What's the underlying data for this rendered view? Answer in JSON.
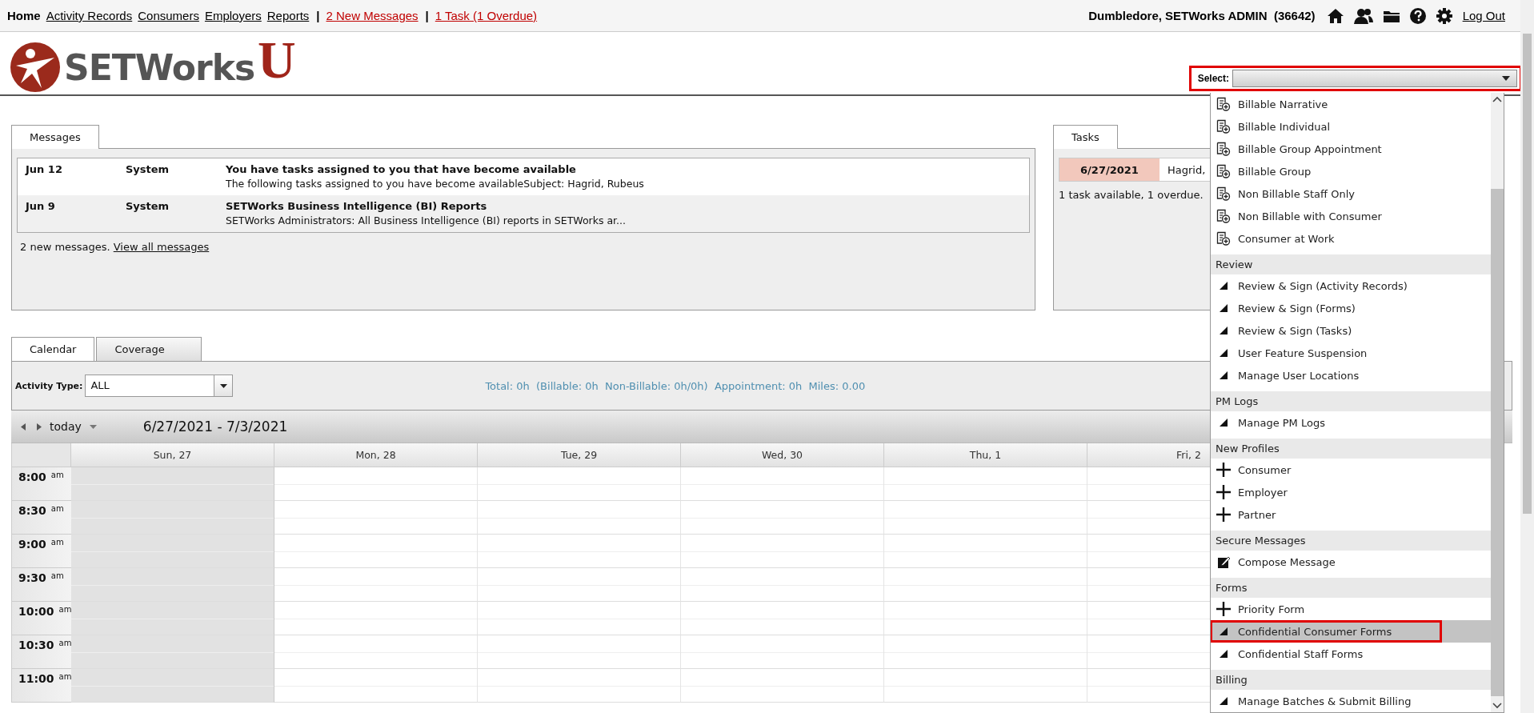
{
  "nav": {
    "links": [
      {
        "label": "Home",
        "selected": true
      },
      {
        "label": "Activity Records",
        "selected": false
      },
      {
        "label": "Consumers",
        "selected": false
      },
      {
        "label": "Employers",
        "selected": false
      },
      {
        "label": "Reports",
        "selected": false
      }
    ],
    "separator": "|",
    "alerts": [
      "2 New Messages",
      "1 Task (1 Overdue)"
    ],
    "user": "Dumbledore, SETWorks ADMIN  (36642)",
    "logout": "Log Out"
  },
  "logo": {
    "name": "SETWorks",
    "letter": "U"
  },
  "select": {
    "label": "Select:",
    "open": true
  },
  "messages": {
    "tab": "Messages",
    "rows": [
      {
        "date": "Jun 12",
        "from": "System",
        "subject": "You have tasks assigned to you that have become available",
        "preview": "The following tasks assigned to you have become availableSubject: Hagrid, Rubeus"
      },
      {
        "date": "Jun 9",
        "from": "System",
        "subject": "SETWorks Business Intelligence (BI) Reports",
        "preview": "SETWorks Administrators: All Business Intelligence (BI) reports in SETWorks ar..."
      }
    ],
    "summary": "2 new messages.",
    "link": "View all messages"
  },
  "tasks": {
    "tab": "Tasks",
    "rows": [
      {
        "date": "6/27/2021",
        "name": "Hagrid,",
        "overdue": true
      }
    ],
    "summary": "1 task available, 1 overdue."
  },
  "calendar": {
    "tabs": [
      {
        "label": "Calendar",
        "selected": true
      },
      {
        "label": "Coverage",
        "selected": false
      }
    ],
    "activity_label": "Activity Type:",
    "activity_value": "ALL",
    "totals": "Total: 0h  (Billable: 0h  Non-Billable: 0h/0h)  Appointment: 0h  Miles: 0.00",
    "today": "today",
    "range": "6/27/2021 - 7/3/2021",
    "days": [
      {
        "label": "Sun, 27",
        "shaded": true
      },
      {
        "label": "Mon, 28",
        "shaded": false
      },
      {
        "label": "Tue, 29",
        "shaded": false
      },
      {
        "label": "Wed, 30",
        "shaded": false
      },
      {
        "label": "Thu, 1",
        "shaded": false
      },
      {
        "label": "Fri, 2",
        "shaded": false
      }
    ],
    "times": [
      {
        "time": "8:00",
        "period": "am"
      },
      {
        "time": "8:30",
        "period": "am"
      },
      {
        "time": "9:00",
        "period": "am"
      },
      {
        "time": "9:30",
        "period": "am"
      },
      {
        "time": "10:00",
        "period": "am"
      },
      {
        "time": "10:30",
        "period": "am"
      },
      {
        "time": "11:00",
        "period": "am"
      }
    ]
  },
  "menu": {
    "items": [
      {
        "kind": "form",
        "label": "Billable Narrative",
        "selected": false
      },
      {
        "kind": "form",
        "label": "Billable Individual",
        "selected": false
      },
      {
        "kind": "form",
        "label": "Billable Group Appointment",
        "selected": false
      },
      {
        "kind": "form",
        "label": "Billable Group",
        "selected": false
      },
      {
        "kind": "form",
        "label": "Non Billable Staff Only",
        "selected": false
      },
      {
        "kind": "form",
        "label": "Non Billable with Consumer",
        "selected": false
      },
      {
        "kind": "form",
        "label": "Consumer at Work",
        "selected": false
      },
      {
        "kind": "header",
        "label": "Review"
      },
      {
        "kind": "link",
        "label": "Review & Sign (Activity Records)",
        "selected": false
      },
      {
        "kind": "link",
        "label": "Review & Sign (Forms)",
        "selected": false
      },
      {
        "kind": "link",
        "label": "Review & Sign (Tasks)",
        "selected": false
      },
      {
        "kind": "link",
        "label": "User Feature Suspension",
        "selected": false
      },
      {
        "kind": "link",
        "label": "Manage User Locations",
        "selected": false
      },
      {
        "kind": "header",
        "label": "PM Logs"
      },
      {
        "kind": "link",
        "label": "Manage PM Logs",
        "selected": false
      },
      {
        "kind": "header",
        "label": "New Profiles"
      },
      {
        "kind": "add",
        "label": "Consumer",
        "selected": false
      },
      {
        "kind": "add",
        "label": "Employer",
        "selected": false
      },
      {
        "kind": "add",
        "label": "Partner",
        "selected": false
      },
      {
        "kind": "header",
        "label": "Secure Messages"
      },
      {
        "kind": "compose",
        "label": "Compose Message",
        "selected": false
      },
      {
        "kind": "header",
        "label": "Forms"
      },
      {
        "kind": "add",
        "label": "Priority Form",
        "selected": false
      },
      {
        "kind": "link",
        "label": "Confidential Consumer Forms",
        "selected": true
      },
      {
        "kind": "link",
        "label": "Confidential Staff Forms",
        "selected": false
      },
      {
        "kind": "header",
        "label": "Billing"
      },
      {
        "kind": "link",
        "label": "Manage Batches & Submit Billing",
        "selected": false
      }
    ]
  }
}
